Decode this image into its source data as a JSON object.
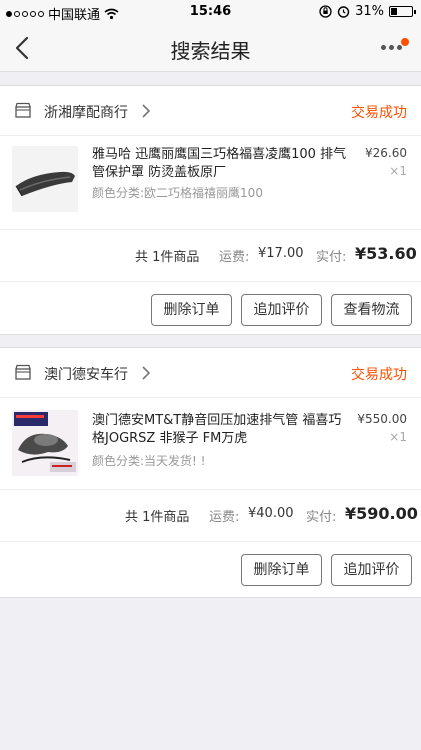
{
  "status_bar": {
    "carrier": "中国联通",
    "time": "15:46",
    "battery": "31%",
    "battery_level": 0.31
  },
  "nav": {
    "title": "搜索结果"
  },
  "orders": [
    {
      "shop": "浙湘摩配商行",
      "status": "交易成功",
      "item": {
        "title": "雅马哈 迅鹰丽鹰国三巧格福喜凌鹰100 排气管保护罩 防烫盖板原厂",
        "variant": "颜色分类:欧二巧格福禧丽鹰100",
        "price": "¥26.60",
        "qty": "×1"
      },
      "summary": {
        "count": "共 1件商品",
        "shipping_label": "运费:",
        "shipping": "¥17.00",
        "paid_label": "实付:",
        "paid": "¥53.60"
      },
      "buttons": [
        "删除订单",
        "追加评价",
        "查看物流"
      ]
    },
    {
      "shop": "澳门德安车行",
      "status": "交易成功",
      "item": {
        "title": "澳门德安MT&T静音回压加速排气管 福喜巧格JOGRSZ 非猴子 FM万虎",
        "variant": "颜色分类:当天发货! !",
        "price": "¥550.00",
        "qty": "×1"
      },
      "summary": {
        "count": "共 1件商品",
        "shipping_label": "运费:",
        "shipping": "¥40.00",
        "paid_label": "实付:",
        "paid": "¥590.00"
      },
      "buttons": [
        "删除订单",
        "追加评价"
      ]
    }
  ],
  "colors": {
    "accent": "#ff5000",
    "background": "#efeff4"
  }
}
